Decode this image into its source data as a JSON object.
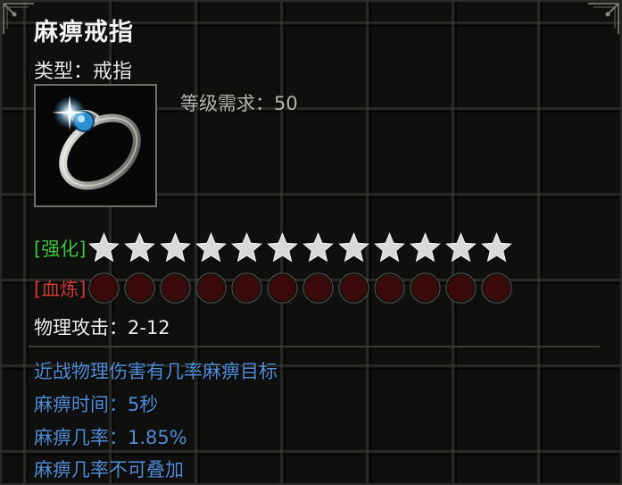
{
  "item": {
    "name": "麻痹戒指",
    "type_line": "类型：戒指",
    "icon": "silver-ring-with-blue-gem",
    "level_requirement": "等级需求：50"
  },
  "enhance": {
    "tag": "[强化]",
    "star_count": 12,
    "star_color": "#d9d9d9",
    "tag_color": "#38c93a"
  },
  "blood_refine": {
    "tag": "[血炼]",
    "slot_count": 12,
    "slot_color": "#3a0a0a",
    "tag_color": "#d63a31"
  },
  "stats": {
    "physical_attack": "物理攻击：2-12"
  },
  "effects": [
    "近战物理伤害有几率麻痹目标",
    "麻痹时间：5秒",
    "麻痹几率：1.85%",
    "麻痹几率不可叠加"
  ],
  "colors": {
    "effect_text": "#4f8ed8",
    "title_text": "#f2f2f2",
    "level_text": "#b7b7ae"
  }
}
